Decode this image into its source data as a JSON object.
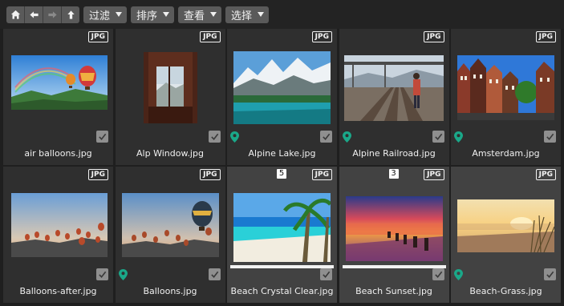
{
  "toolbar": {
    "menus": [
      {
        "label": "过滤"
      },
      {
        "label": "排序"
      },
      {
        "label": "查看"
      },
      {
        "label": "选择"
      }
    ]
  },
  "files": [
    {
      "name": "air balloons.jpg",
      "format": "JPG",
      "selected": false,
      "located": false
    },
    {
      "name": "Alp Window.jpg",
      "format": "JPG",
      "selected": false,
      "located": false
    },
    {
      "name": "Alpine Lake.jpg",
      "format": "JPG",
      "selected": false,
      "located": true
    },
    {
      "name": "Alpine Railroad.jpg",
      "format": "JPG",
      "selected": false,
      "located": true
    },
    {
      "name": "Amsterdam.jpg",
      "format": "JPG",
      "selected": false,
      "located": true
    },
    {
      "name": "Balloons-after.jpg",
      "format": "JPG",
      "selected": false,
      "located": false
    },
    {
      "name": "Balloons.jpg",
      "format": "JPG",
      "selected": false,
      "located": true
    },
    {
      "name": "Beach Crystal Clear.jpg",
      "format": "JPG",
      "selected": true,
      "located": false,
      "badge": "5",
      "progress": 1.0
    },
    {
      "name": "Beach Sunset.jpg",
      "format": "JPG",
      "selected": true,
      "located": false,
      "badge": "3",
      "progress": 1.0
    },
    {
      "name": "Beach-Grass.jpg",
      "format": "JPG",
      "selected": true,
      "located": true
    }
  ],
  "colors": {
    "background": "#1f1f1f",
    "cell": "#2f2f2f",
    "cell_selected": "#424242",
    "button": "#5a5a5a",
    "location_pin": "#1aa889"
  }
}
